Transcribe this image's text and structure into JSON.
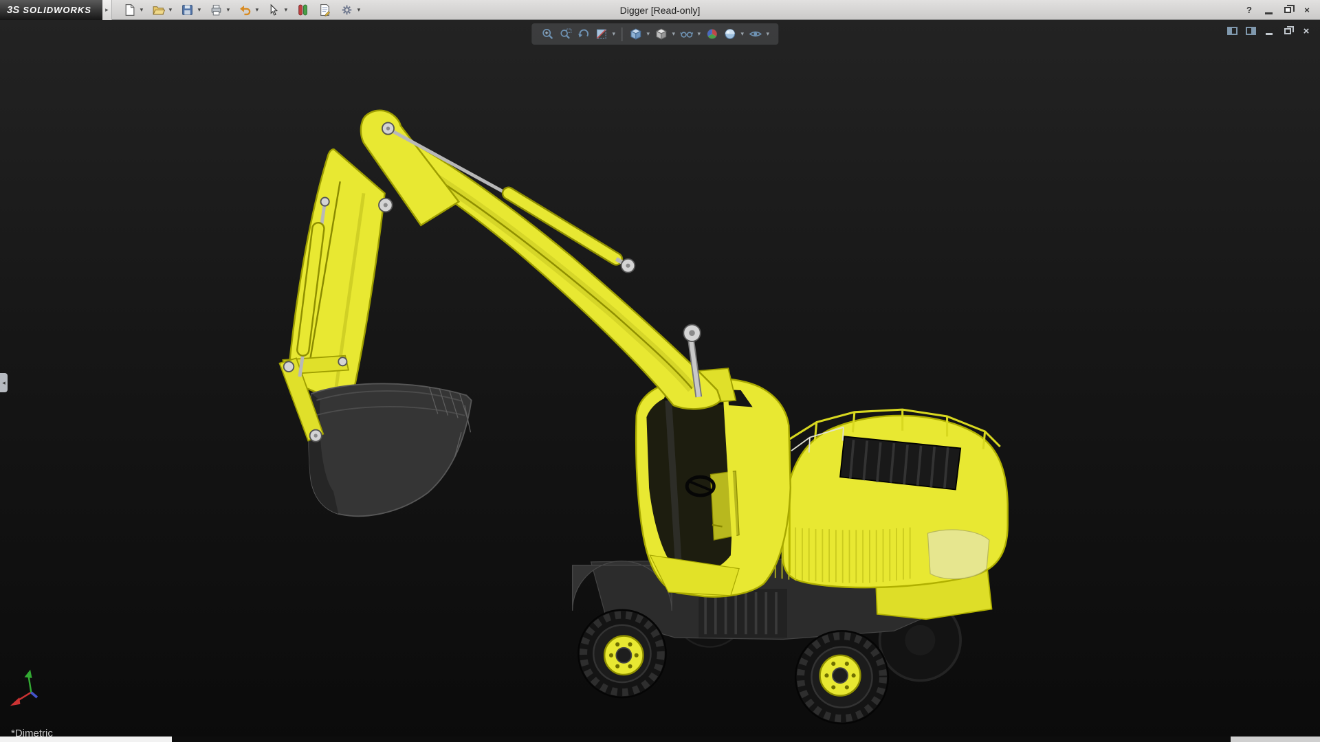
{
  "app": {
    "logo_mark": "3S",
    "logo_text": "SOLIDWORKS",
    "title": "Digger [Read-only]"
  },
  "glyphs": {
    "dropdown": "▾",
    "expand": "▸",
    "collapse": "◂",
    "help": "?",
    "close": "×"
  },
  "quick_access_icons": [
    "new",
    "open",
    "save",
    "print",
    "undo",
    "select",
    "rebuild",
    "file-properties",
    "options"
  ],
  "heads_up_icons": [
    "zoom-to-fit",
    "zoom-to-area",
    "previous-view",
    "section-view",
    "view-orientation",
    "display-style",
    "hide-show-items",
    "edit-appearance",
    "apply-scene",
    "view-settings"
  ],
  "document_window_icons": [
    "featuremanager-pane",
    "display-pane",
    "minimize",
    "restore",
    "close"
  ],
  "window_control_icons": [
    "help",
    "minimize",
    "restore",
    "close"
  ],
  "viewport": {
    "view_label": "*Dimetric",
    "background_color": "#181818",
    "model_primary_color": "#e8e832",
    "model_secondary_color": "#2e2e2e"
  }
}
